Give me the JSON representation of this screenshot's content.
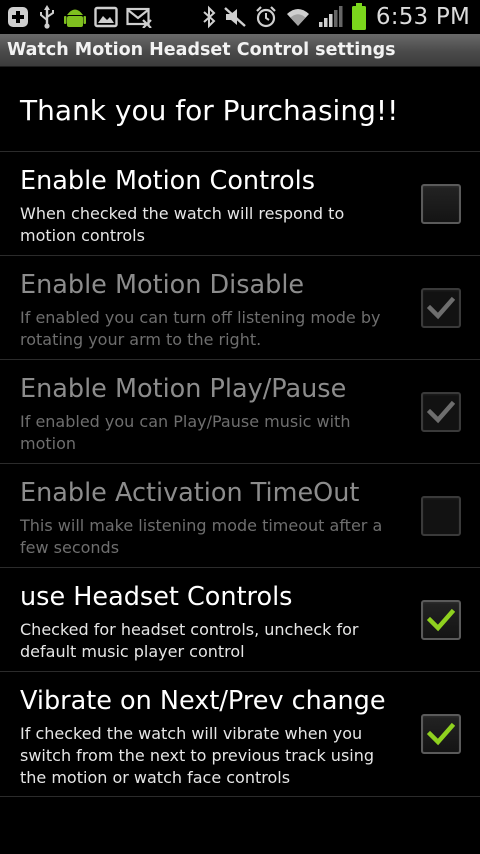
{
  "status_bar": {
    "time": "6:53 PM",
    "left_icons": [
      "plus-box-icon",
      "usb-icon",
      "android-icon",
      "image-icon",
      "mail-icon"
    ],
    "right_icons": [
      "bluetooth-icon",
      "mute-icon",
      "alarm-icon",
      "wifi-icon",
      "signal-icon",
      "battery-icon"
    ]
  },
  "title_bar": {
    "title": "Watch Motion Headset Control settings"
  },
  "header": {
    "text": "Thank you for Purchasing!!"
  },
  "preferences": [
    {
      "title": "Enable Motion Controls",
      "summary": "When checked the watch will respond to motion controls",
      "checked": false,
      "enabled": true
    },
    {
      "title": "Enable Motion Disable",
      "summary": "If enabled you can turn off listening mode by rotating your arm to the right.",
      "checked": true,
      "enabled": false
    },
    {
      "title": "Enable Motion Play/Pause",
      "summary": "If enabled you can Play/Pause music with motion",
      "checked": true,
      "enabled": false
    },
    {
      "title": "Enable Activation TimeOut",
      "summary": "This will make listening mode timeout after a few seconds",
      "checked": false,
      "enabled": false
    },
    {
      "title": "use Headset Controls",
      "summary": "Checked for headset controls, uncheck for default music player control",
      "checked": true,
      "enabled": true
    },
    {
      "title": "Vibrate on Next/Prev change",
      "summary": "If checked the watch will vibrate when you switch from the next to previous track using the motion or watch face controls",
      "checked": true,
      "enabled": true
    }
  ],
  "colors": {
    "check_active": "#8fd11f",
    "check_disabled": "#6e6e6e",
    "battery": "#7bd61c"
  }
}
